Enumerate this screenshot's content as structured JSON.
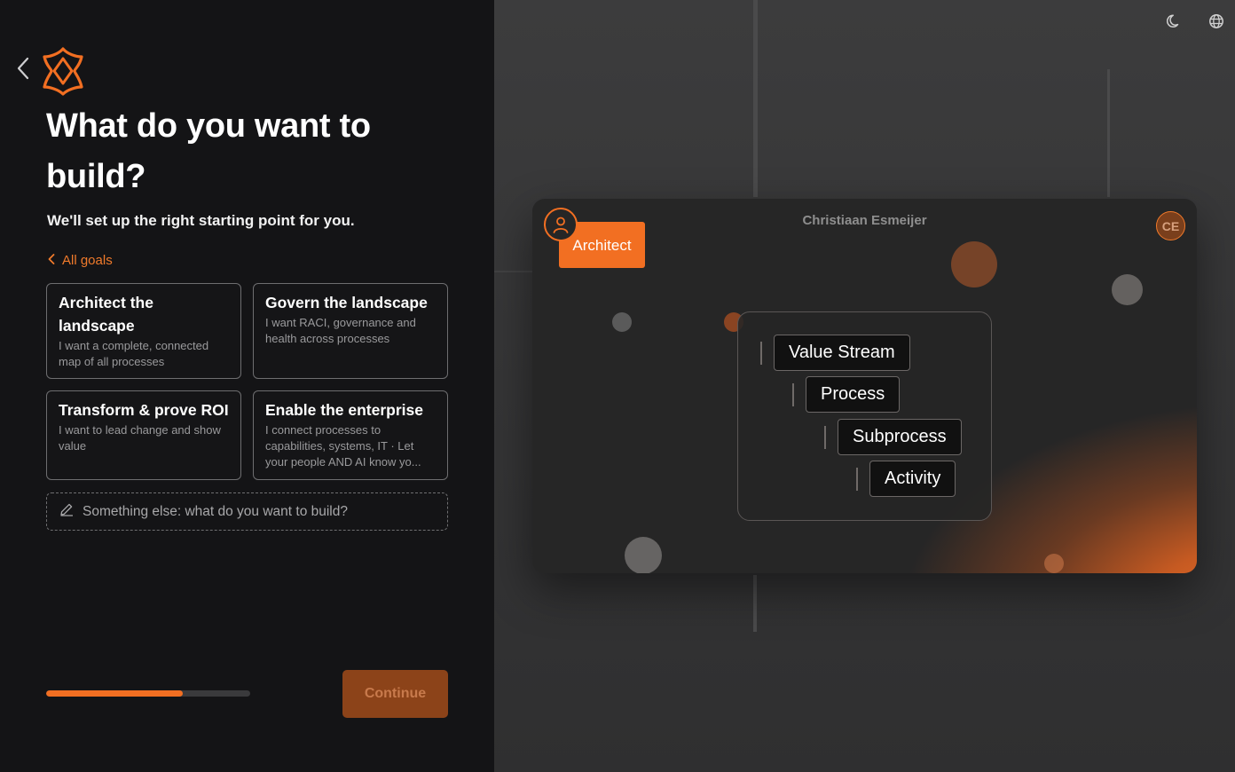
{
  "heading": "What do you want to build?",
  "subheading": "We'll set up the right starting point for you.",
  "back_link": "All goals",
  "goals": [
    {
      "title": "Architect the landscape",
      "description": "I want a complete, connected map of all processes"
    },
    {
      "title": "Govern the landscape",
      "description": "I want RACI, governance and health across processes"
    },
    {
      "title": "Transform & prove ROI",
      "description": "I want to lead change and show value"
    },
    {
      "title": "Enable the enterprise",
      "description": "I connect processes to capabilities, systems, IT · Let your people AND AI know yo..."
    }
  ],
  "custom_goal_placeholder": "Something else: what do you want to build?",
  "progress_fraction": 0.67,
  "continue_label": "Continue",
  "preview": {
    "user_name": "Christiaan Esmeijer",
    "user_initials": "CE",
    "role": "Architect",
    "hierarchy": [
      "Value Stream",
      "Process",
      "Subprocess",
      "Activity"
    ]
  },
  "colors": {
    "accent": "#f26f22",
    "continue_disabled": "#8c4319"
  },
  "icons": [
    "back-chevron-icon",
    "brand-logo-icon",
    "chevron-left-icon",
    "pencil-icon",
    "moon-icon",
    "globe-icon",
    "user-icon"
  ]
}
